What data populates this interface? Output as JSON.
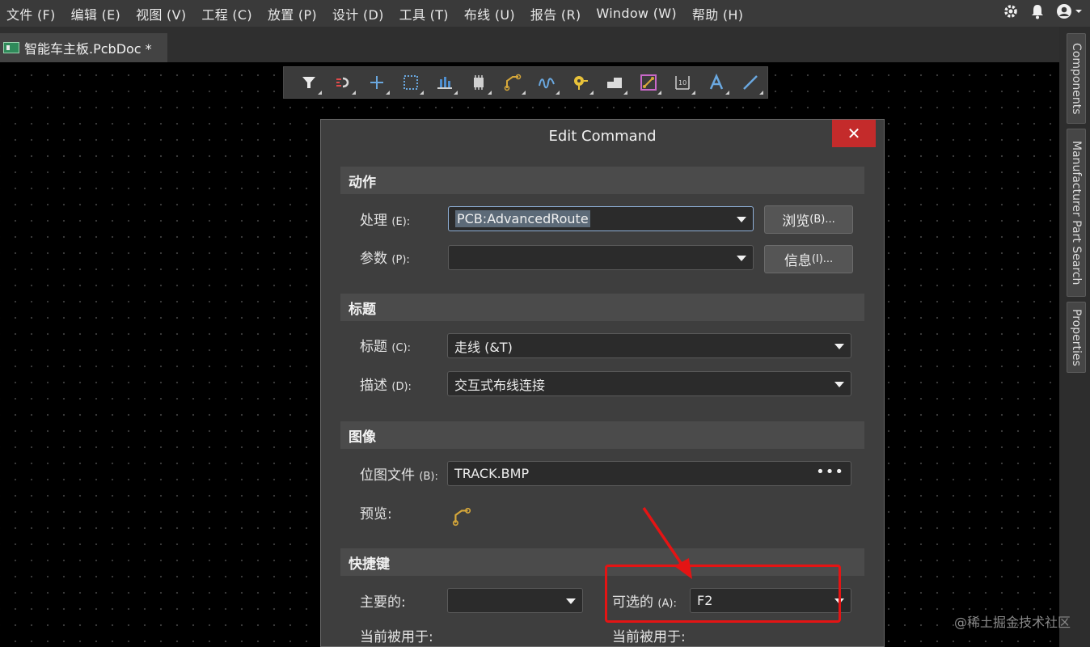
{
  "menubar": {
    "items": [
      "文件 (F)",
      "编辑 (E)",
      "视图 (V)",
      "工程 (C)",
      "放置 (P)",
      "设计 (D)",
      "工具 (T)",
      "布线 (U)",
      "报告 (R)",
      "Window (W)",
      "帮助 (H)"
    ],
    "icons": [
      "gear-icon",
      "bell-icon",
      "user-icon"
    ]
  },
  "tab": {
    "label": "智能车主板.PcbDoc *"
  },
  "side_panel": {
    "tabs": [
      "Components",
      "Manufacturer Part Search",
      "Properties"
    ]
  },
  "toolbar": {
    "tools": [
      "filter-icon",
      "route-icon",
      "cross-icon",
      "select-rect-icon",
      "align-icon",
      "component-icon",
      "track-icon",
      "diff-pair-icon",
      "via-icon",
      "fill-icon",
      "region-icon",
      "dimension-icon",
      "text-icon",
      "line-icon"
    ]
  },
  "dialog": {
    "title": "Edit Command",
    "close_glyph": "✕",
    "sections": {
      "action": "动作",
      "caption": "标题",
      "image": "图像",
      "shortcut": "快捷键"
    },
    "process": {
      "label": "处理",
      "accel": "(E):",
      "value": "PCB:AdvancedRoute",
      "browse": "浏览",
      "browse_accel": "(B)..."
    },
    "params": {
      "label": "参数",
      "accel": "(P):",
      "value": "",
      "info": "信息",
      "info_accel": "(I)..."
    },
    "caption": {
      "label": "标题",
      "accel": "(C):",
      "value": "走线 (&T)"
    },
    "description": {
      "label": "描述",
      "accel": "(D):",
      "value": "交互式布线连接"
    },
    "bitmap": {
      "label": "位图文件",
      "accel": "(B):",
      "value": "TRACK.BMP",
      "more": "•••"
    },
    "preview": {
      "label": "预览:"
    },
    "primary": {
      "label": "主要的:",
      "value": ""
    },
    "alternate": {
      "label": "可选的",
      "accel": "(A):",
      "value": "F2"
    },
    "used_by_left": "当前被用于:",
    "used_by_right": "当前被用于:"
  },
  "watermark": "@稀土掘金技术社区",
  "colors": {
    "accent_red": "#e41414",
    "close_red": "#c42b2b"
  }
}
